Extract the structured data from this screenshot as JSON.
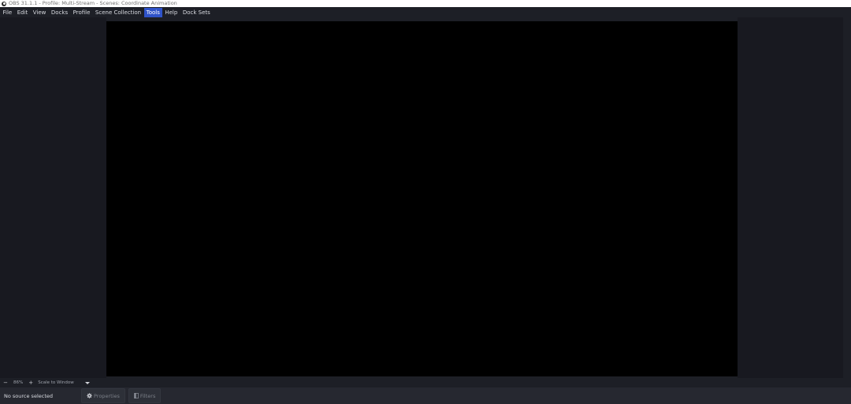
{
  "window": {
    "title": "OBS 31.1.1 - Profile: Multi-Stream - Scenes: Coordinate Animation",
    "app_icon": "obs-logo-icon"
  },
  "menubar": {
    "items": [
      {
        "label": "File"
      },
      {
        "label": "Edit"
      },
      {
        "label": "View"
      },
      {
        "label": "Docks"
      },
      {
        "label": "Profile"
      },
      {
        "label": "Scene Collection"
      },
      {
        "label": "Tools",
        "active": true
      },
      {
        "label": "Help"
      },
      {
        "label": "Dock Sets"
      }
    ]
  },
  "zoom": {
    "minus_label": "−",
    "level": "86%",
    "plus_label": "+",
    "scale_mode": "Scale to Window",
    "dropdown_icon": "chevron-down-icon"
  },
  "source_toolbar": {
    "status": "No source selected",
    "properties_label": "Properties",
    "properties_icon": "gear-icon",
    "filters_label": "Filters",
    "filters_icon": "filters-icon"
  },
  "colors": {
    "background": "#1d1f26",
    "panel": "#181920",
    "preview": "#000000",
    "menu_highlight": "#2f53c9"
  }
}
